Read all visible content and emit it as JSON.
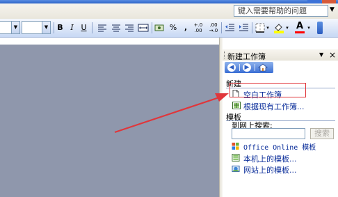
{
  "app": {
    "help_placeholder": "键入需要帮助的问题",
    "help_dropdown_glyph": "▼"
  },
  "toolbar": {
    "bold": "B",
    "italic": "I",
    "underline": "U",
    "percent": "%",
    "comma": ",",
    "increase_decimal": "+.0\n.00",
    "decrease_decimal": ".00\n→.0",
    "fill_color": "#ffff00",
    "font_color": "#ff0000",
    "font_color_letter": "A",
    "icons": [
      "align-left-icon",
      "align-center-icon",
      "align-right-icon",
      "merge-center-icon",
      "currency-icon",
      "outdent-icon",
      "indent-icon",
      "borders-icon",
      "fill-color-icon",
      "font-color-icon"
    ]
  },
  "task_pane": {
    "title": "新建工作簿",
    "menu_glyph": "▼",
    "close_glyph": "×",
    "new_section": "新建",
    "blank_workbook": "空白工作簿",
    "from_existing": "根据现有工作簿...",
    "templates_section": "模板",
    "search_online_label": "到网上搜索:",
    "search_button": "搜索",
    "office_online_templates": "Office Online 模板",
    "local_templates": "本机上的模板...",
    "website_templates": "网站上的模板..."
  },
  "annotation": {
    "highlight_color": "#e0363b",
    "arrow_color": "#e0363b"
  }
}
